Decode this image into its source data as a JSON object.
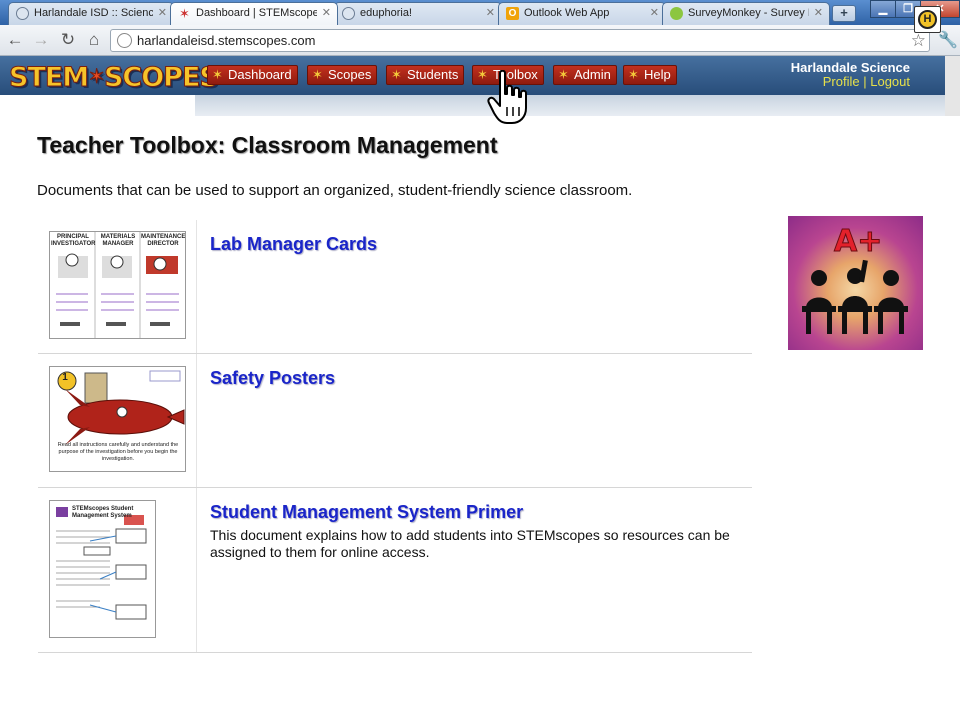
{
  "browser": {
    "tabs": [
      {
        "label": "Harlandale ISD :: Science",
        "icon": "globe-icon",
        "active": false
      },
      {
        "label": "Dashboard | STEMscopes",
        "icon": "stemscopes-star-icon",
        "active": true
      },
      {
        "label": "eduphoria!",
        "icon": "globe-icon",
        "active": false
      },
      {
        "label": "Outlook Web App",
        "icon": "outlook-icon",
        "active": false
      },
      {
        "label": "SurveyMonkey - Survey R",
        "icon": "surveymonkey-icon",
        "active": false
      }
    ],
    "url": "harlandaleisd.stemscopes.com"
  },
  "site": {
    "logo_text": "STEMSCOPES",
    "nav": [
      "Dashboard",
      "Scopes",
      "Students",
      "Toolbox",
      "Admin",
      "Help"
    ],
    "user": {
      "name": "Harlandale Science",
      "profile_label": "Profile",
      "separator": "|",
      "logout_label": "Logout",
      "badge_letter": "H"
    }
  },
  "page": {
    "title": "Teacher Toolbox: Classroom Management",
    "description": "Documents that can be used to support an organized, student-friendly science classroom.",
    "items": [
      {
        "title": "Lab Manager Cards",
        "description": "",
        "thumb_labels": [
          "PRINCIPAL INVESTIGATOR",
          "MATERIALS MANAGER",
          "MAINTENANCE DIRECTOR"
        ]
      },
      {
        "title": "Safety Posters",
        "description": "",
        "thumb_number": "1",
        "thumb_caption": "Read all instructions carefully and understand the purpose of the investigation before you begin the investigation."
      },
      {
        "title": "Student Management System Primer",
        "description": "This document explains how to add students into STEMscopes so resources can be assigned to them for online access.",
        "thumb_heading": "STEMscopes Student Management System"
      }
    ],
    "side_image_text": "A+"
  },
  "colors": {
    "header_blue": "#2f5888",
    "nav_red": "#b1291a",
    "link_blue": "#1a25c9",
    "profile_yellow": "#e6e04a"
  }
}
